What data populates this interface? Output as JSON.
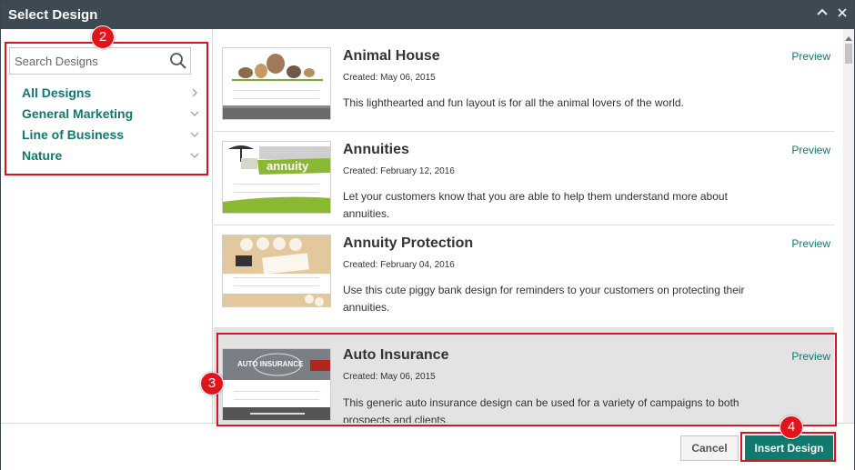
{
  "window": {
    "title": "Select Design"
  },
  "search": {
    "placeholder": "Search Designs",
    "value": ""
  },
  "categories": [
    {
      "label": "All Designs",
      "icon": "chevron-right-icon"
    },
    {
      "label": "General Marketing",
      "icon": "chevron-down-icon"
    },
    {
      "label": "Line of Business",
      "icon": "chevron-down-icon"
    },
    {
      "label": "Nature",
      "icon": "chevron-down-icon"
    }
  ],
  "designs": [
    {
      "name": "Animal House",
      "created": "Created: May 06, 2015",
      "description": "This lighthearted and fun layout is for all the animal lovers of the world.",
      "preview": "Preview"
    },
    {
      "name": "Annuities",
      "created": "Created: February 12, 2016",
      "description": "Let your customers know that you are able to help them understand more about annuities.",
      "preview": "Preview",
      "thumb_text": "annuity"
    },
    {
      "name": "Annuity Protection",
      "created": "Created: February 04, 2016",
      "description": "Use this cute piggy bank design for reminders to your customers on protecting their annuities.",
      "preview": "Preview"
    },
    {
      "name": "Auto Insurance",
      "created": "Created: May 06, 2015",
      "description": "This generic auto insurance design can be used for a variety of campaigns to both prospects and clients.",
      "preview": "Preview",
      "thumb_text": "AUTO INSURANCE",
      "selected": true
    }
  ],
  "footer": {
    "cancel_label": "Cancel",
    "insert_label": "Insert Design"
  },
  "callouts": [
    "2",
    "3",
    "4"
  ],
  "colors": {
    "titlebar": "#3e4a53",
    "accent": "#0f7a6d",
    "highlight": "#d9141b",
    "selected_row": "#e3e3e3"
  }
}
